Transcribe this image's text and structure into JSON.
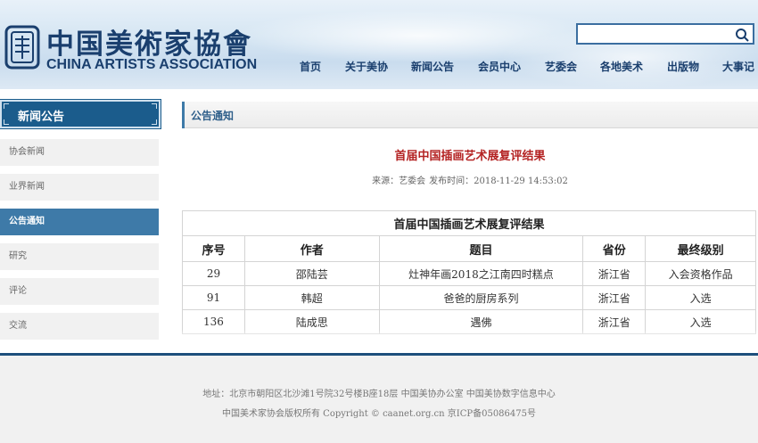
{
  "header": {
    "logo_cn": "中国美術家協會",
    "logo_en": "CHINA ARTISTS ASSOCIATION",
    "search_placeholder": "",
    "nav": [
      "首页",
      "关于美协",
      "新闻公告",
      "会员中心",
      "艺委会",
      "各地美术",
      "出版物",
      "大事记"
    ]
  },
  "sidebar": {
    "title": "新闻公告",
    "items": [
      {
        "label": "协会新闻",
        "active": false
      },
      {
        "label": "业界新闻",
        "active": false
      },
      {
        "label": "公告通知",
        "active": true
      },
      {
        "label": "研究",
        "active": false
      },
      {
        "label": "评论",
        "active": false
      },
      {
        "label": "交流",
        "active": false
      }
    ]
  },
  "main": {
    "section_title": "公告通知",
    "article_title": "首届中国插画艺术展复评结果",
    "meta_source": "来源：艺委会",
    "meta_time": "发布时间：2018-11-29 14:53:02",
    "table": {
      "title": "首届中国插画艺术展复评结果",
      "headers": [
        "序号",
        "作者",
        "题目",
        "省份",
        "最终级别"
      ],
      "rows": [
        [
          "29",
          "邵陆芸",
          "灶神年画2018之江南四时糕点",
          "浙江省",
          "入会资格作品"
        ],
        [
          "91",
          "韩超",
          "爸爸的厨房系列",
          "浙江省",
          "入选"
        ],
        [
          "136",
          "陆成思",
          "遇佛",
          "浙江省",
          "入选"
        ]
      ]
    }
  },
  "footer": {
    "line1": "地址：北京市朝阳区北沙滩1号院32号楼B座18层  中国美协办公室  中国美协数字信息中心",
    "line2": "中国美术家协会版权所有 Copyright © caanet.org.cn 京ICP备05086475号"
  },
  "colors": {
    "brand": "#1a3f6e",
    "accent": "#3e7aa8",
    "title_red": "#b42323"
  }
}
